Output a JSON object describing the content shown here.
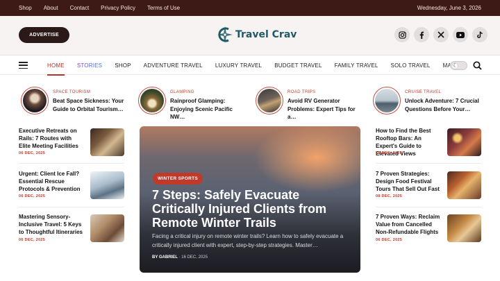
{
  "topbar": {
    "links": [
      "Shop",
      "About",
      "Contact",
      "Privacy Policy",
      "Terms of Use"
    ],
    "date": "Wednesday, June 3, 2026"
  },
  "header": {
    "advertise": "ADVERTISE",
    "logo_text": "Travel Crav",
    "socials": [
      "instagram-icon",
      "facebook-icon",
      "x-icon",
      "youtube-icon",
      "tiktok-icon"
    ]
  },
  "nav": {
    "items": [
      "HOME",
      "STORIES",
      "SHOP",
      "ADVENTURE TRAVEL",
      "LUXURY TRAVEL",
      "BUDGET TRAVEL",
      "FAMILY TRAVEL",
      "SOLO TRAVEL",
      "MAIS"
    ]
  },
  "stories": [
    {
      "category": "SPACE TOURISM",
      "title": "Beat Space Sickness: Your Guide to Orbital Tourism…"
    },
    {
      "category": "GLAMPING",
      "title": "Rainproof Glamping: Enjoying Scenic Pacific NW…"
    },
    {
      "category": "ROAD TRIPS",
      "title": "Avoid RV Generator Problems: Expert Tips for a…"
    },
    {
      "category": "CRUISE TRAVEL",
      "title": "Unlock Adventure: 7 Crucial Questions Before Your…"
    }
  ],
  "left_posts": [
    {
      "title": "Executive Retreats on Rails: 7 Routes with Elite Meeting Facilities",
      "date": "06 DEC, 2025"
    },
    {
      "title": "Urgent: Client Ice Fall? Essential Rescue Protocols & Prevention",
      "date": "06 DEC, 2025"
    },
    {
      "title": "Mastering Sensory-Inclusive Travel: 5 Keys to Thoughtful Itineraries",
      "date": "06 DEC, 2025"
    }
  ],
  "right_posts": [
    {
      "title": "How to Find the Best Rooftop Bars: An Expert's Guide to Elevated Views",
      "date": "15 DEC, 2025"
    },
    {
      "title": "7 Proven Strategies: Design Food Festival Tours That Sell Out Fast",
      "date": "08 DEC, 2025"
    },
    {
      "title": "7 Proven Ways: Reclaim Value from Cancelled Non-Refundable Flights",
      "date": "06 DEC, 2025"
    }
  ],
  "hero": {
    "category": "WINTER SPORTS",
    "title": "7 Steps: Safely Evacuate Critically Injured Clients from Remote Winter Trails",
    "excerpt": "Facing a critical injury on remote winter trails? Learn how to safely evacuate a critically injured client with expert, step-by-step strategies. Master…",
    "by_label": "BY GABRIEL",
    "date": "16 DEC, 2025"
  },
  "colors": {
    "accent": "#c0392b",
    "topbar": "#3d1a16",
    "logo": "#1f5a66"
  }
}
